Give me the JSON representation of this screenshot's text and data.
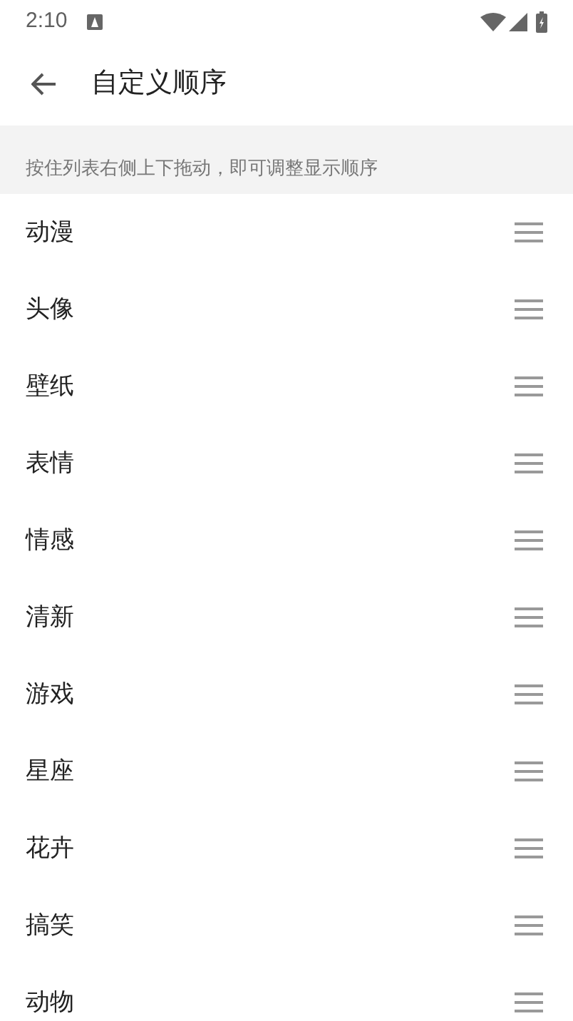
{
  "status_bar": {
    "time": "2:10"
  },
  "toolbar": {
    "title": "自定义顺序"
  },
  "hint": "按住列表右侧上下拖动，即可调整显示顺序",
  "items": [
    {
      "label": "动漫"
    },
    {
      "label": "头像"
    },
    {
      "label": "壁纸"
    },
    {
      "label": "表情"
    },
    {
      "label": "情感"
    },
    {
      "label": "清新"
    },
    {
      "label": "游戏"
    },
    {
      "label": "星座"
    },
    {
      "label": "花卉"
    },
    {
      "label": "搞笑"
    },
    {
      "label": "动物"
    }
  ]
}
